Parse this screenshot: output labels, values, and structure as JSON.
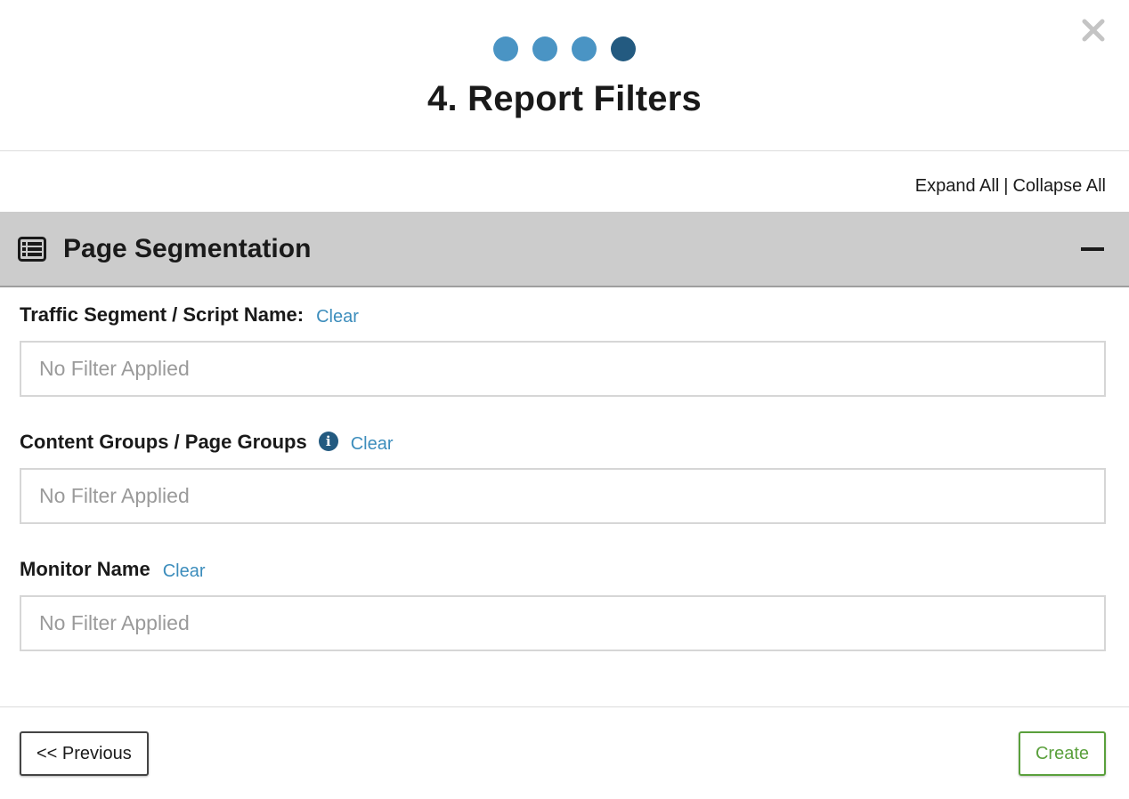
{
  "wizard": {
    "step_count": 4,
    "current_step": 4,
    "title": "4. Report Filters",
    "close_icon": "close-icon"
  },
  "toggles": {
    "expand_all": "Expand All",
    "separator": "|",
    "collapse_all": "Collapse All"
  },
  "section": {
    "icon": "table-list-icon",
    "title": "Page Segmentation",
    "collapse_icon": "minus-icon"
  },
  "fields": [
    {
      "label": "Traffic Segment / Script Name:",
      "clear": "Clear",
      "placeholder": "No Filter Applied",
      "has_info": false
    },
    {
      "label": "Content Groups / Page Groups",
      "clear": "Clear",
      "placeholder": "No Filter Applied",
      "has_info": true,
      "info_icon": "info-icon"
    },
    {
      "label": "Monitor Name",
      "clear": "Clear",
      "placeholder": "No Filter Applied",
      "has_info": false
    }
  ],
  "footer": {
    "previous_label": "<< Previous",
    "create_label": "Create"
  },
  "colors": {
    "step_inactive": "#4a94c4",
    "step_active": "#235a80",
    "link": "#3c8dbc",
    "create_green": "#5aa03c",
    "section_bg": "#cccccc"
  }
}
